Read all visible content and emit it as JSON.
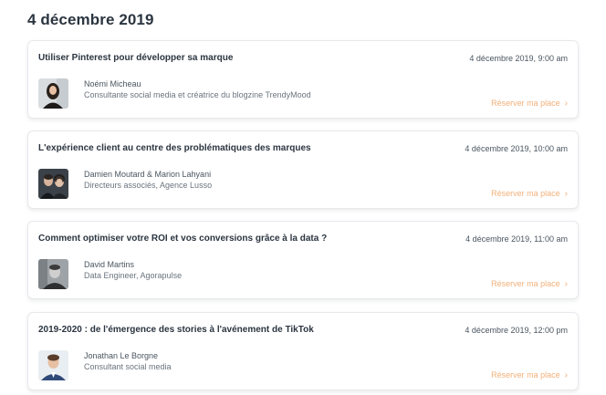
{
  "day": {
    "title": "4 décembre 2019"
  },
  "sessions": [
    {
      "title": "Utiliser Pinterest pour développer sa marque",
      "date": "4 décembre 2019, 9:00 am",
      "speaker": "Noémi Micheau",
      "role": "Consultante social media et créatrice du blogzine TrendyMood",
      "cta": "Réserver ma place",
      "cta_icon": "chevron-right-icon"
    },
    {
      "title": "L'expérience client au centre des problématiques des marques",
      "date": "4 décembre 2019, 10:00 am",
      "speaker": "Damien Moutard & Marion Lahyani",
      "role": "Directeurs associés, Agence Lusso",
      "cta": "Réserver ma place",
      "cta_icon": "chevron-right-icon"
    },
    {
      "title": "Comment optimiser votre ROI et vos conversions grâce à la data ?",
      "date": "4 décembre 2019, 11:00 am",
      "speaker": "David Martins",
      "role": "Data Engineer, Agorapulse",
      "cta": "Réserver ma place",
      "cta_icon": "chevron-right-icon"
    },
    {
      "title": "2019-2020 : de l'émergence des stories à l'avénement de TikTok",
      "date": "4 décembre 2019, 12:00 pm",
      "speaker": "Jonathan Le Borgne",
      "role": "Consultant social media",
      "cta": "Réserver ma place",
      "cta_icon": "chevron-right-icon"
    }
  ],
  "colors": {
    "accent": "#f2b07a",
    "title": "#2b3540",
    "text": "#4a5560",
    "border": "#e6e9ec"
  }
}
